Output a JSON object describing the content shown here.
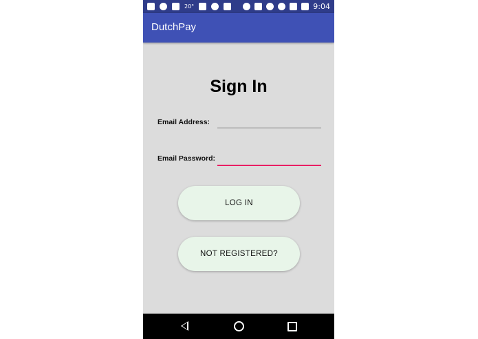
{
  "status_bar": {
    "temperature": "20°",
    "time": "9:04"
  },
  "app_bar": {
    "title": "DutchPay"
  },
  "sign_in": {
    "heading": "Sign In",
    "email_label": "Email Address:",
    "email_value": "",
    "password_label": "Email Password:",
    "password_value": ""
  },
  "buttons": {
    "login_label": "LOG IN",
    "register_label": "NOT REGISTERED?"
  },
  "colors": {
    "status_bar": "#2f3c8a",
    "app_bar": "#3f51b5",
    "background": "#dcdcdc",
    "accent": "#e91e63",
    "button": "#e8f5e9"
  },
  "nav_bar": {
    "icons": [
      "back-icon",
      "home-icon",
      "recents-icon"
    ]
  }
}
